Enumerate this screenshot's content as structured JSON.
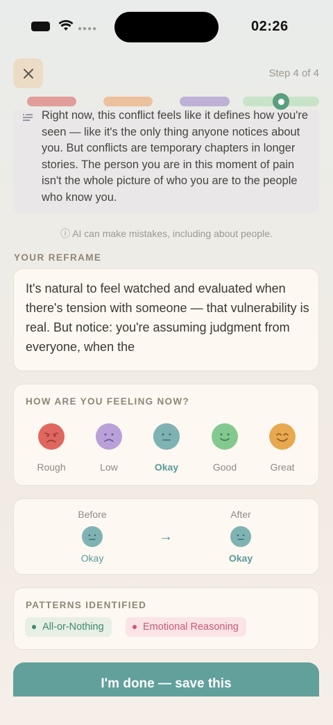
{
  "status": {
    "time": "02:26"
  },
  "header": {
    "step": "Step 4 of 4"
  },
  "progress": {
    "segments": [
      "#e19e99",
      "#ecc19e",
      "#bdb2d6",
      "#c9e3c9"
    ],
    "current_step": 4,
    "total_steps": 4
  },
  "insight": {
    "text": "Right now, this conflict feels like it defines how you're seen — like it's the only thing anyone notices about you. But conflicts are temporary chapters in longer stories. The person you are in this moment of pain isn't the whole picture of who you are to the people who know you."
  },
  "disclaimer": "ⓘ AI can make mistakes, including about people.",
  "reframe": {
    "label": "YOUR REFRAME",
    "text": "It's natural to feel watched and evaluated when there's tension with someone — that vulnerability is real. But notice: you're assuming judgment from everyone, when the"
  },
  "feeling": {
    "title": "HOW ARE YOU FEELING NOW?",
    "selected": "Okay",
    "moods": [
      {
        "label": "Rough",
        "color": "#e0675f"
      },
      {
        "label": "Low",
        "color": "#b9a0d8"
      },
      {
        "label": "Okay",
        "color": "#7fb3b3"
      },
      {
        "label": "Good",
        "color": "#83c98f"
      },
      {
        "label": "Great",
        "color": "#e8a84f"
      }
    ]
  },
  "comparison": {
    "before_label": "Before",
    "before_value": "Okay",
    "after_label": "After",
    "after_value": "Okay"
  },
  "patterns": {
    "title": "PATTERNS IDENTIFIED",
    "items": [
      {
        "label": "All-or-Nothing",
        "text_color": "#3f8a6b",
        "bg": "#e8efe5",
        "dot": "#3f8a6b"
      },
      {
        "label": "Emotional Reasoning",
        "text_color": "#c9587a",
        "bg": "#fbe4e6",
        "dot": "#d9537a"
      }
    ]
  },
  "cta": {
    "label": "I'm done — save this"
  }
}
